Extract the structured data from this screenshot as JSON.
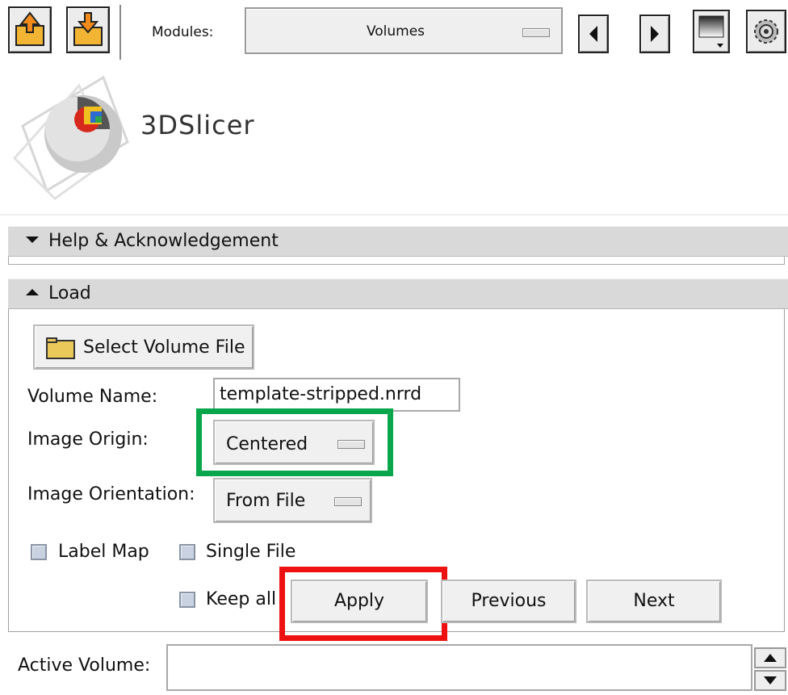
{
  "toolbar": {
    "modules_label": "Modules:",
    "module_selected": "Volumes"
  },
  "logo": {
    "text": "3DSlicer"
  },
  "sections": {
    "help": "Help & Acknowledgement",
    "load": "Load"
  },
  "load": {
    "select_file_label": "Select Volume File",
    "volume_name_label": "Volume Name:",
    "volume_name_value": "template-stripped.nrrd",
    "image_origin_label": "Image Origin:",
    "image_origin_value": "Centered",
    "image_orientation_label": "Image Orientation:",
    "image_orientation_value": "From File",
    "label_map_label": "Label Map",
    "single_file_label": "Single File",
    "keep_all_label": "Keep all",
    "apply_label": "Apply",
    "previous_label": "Previous",
    "next_label": "Next"
  },
  "active_volume": {
    "label": "Active Volume:",
    "value": ""
  },
  "colors": {
    "highlight_green": "#0aa64b",
    "highlight_red": "#ee1111"
  }
}
